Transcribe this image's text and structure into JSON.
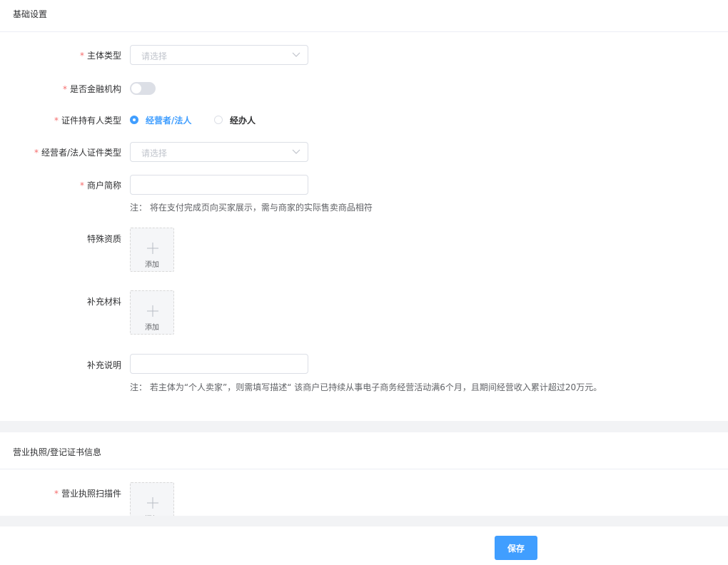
{
  "sections": {
    "basic": {
      "title": "基础设置"
    },
    "license": {
      "title": "营业执照/登记证书信息"
    }
  },
  "required_mark": "*",
  "fields": {
    "entity_type": {
      "label": "主体类型",
      "placeholder": "请选择"
    },
    "is_financial": {
      "label": "是否金融机构",
      "on": false
    },
    "holder_type": {
      "label": "证件持有人类型",
      "options": [
        {
          "label": "经营者/法人",
          "checked": true
        },
        {
          "label": "经办人",
          "checked": false
        }
      ]
    },
    "operator_id_type": {
      "label": "经营者/法人证件类型",
      "placeholder": "请选择"
    },
    "merchant_short_name": {
      "label": "商户简称",
      "value": "",
      "note": "注：  将在支付完成页向买家展示，需与商家的实际售卖商品相符"
    },
    "special_qualification": {
      "label": "特殊资质",
      "upload_label": "添加"
    },
    "supplementary_material": {
      "label": "补充材料",
      "upload_label": "添加"
    },
    "supplementary_note": {
      "label": "补充说明",
      "value": "",
      "note": "注：  若主体为“个人卖家”，则需填写描述“ 该商户已持续从事电子商务经营活动满6个月，且期间经营收入累计超过20万元。"
    },
    "license_scan": {
      "label": "营业执照扫描件",
      "upload_label": "添加"
    }
  },
  "footer": {
    "save_label": "保存"
  },
  "colors": {
    "primary": "#409eff",
    "required": "#f56c6c",
    "border": "#dcdfe6",
    "band": "#f2f3f5"
  }
}
